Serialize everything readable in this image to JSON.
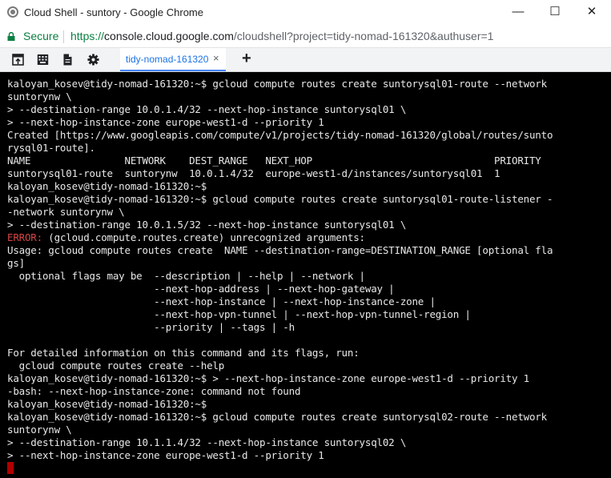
{
  "window": {
    "title": "Cloud Shell - suntory - Google Chrome",
    "controls": {
      "minimize": "—",
      "maximize": "☐",
      "close": "✕"
    }
  },
  "address_bar": {
    "secure_label": "Secure",
    "url_scheme": "https://",
    "url_host": "console.cloud.google.com",
    "url_path": "/cloudshell?project=tidy-nomad-161320&authuser=1"
  },
  "toolbar": {
    "icons": [
      "open-in-new-window-icon",
      "keyboard-icon",
      "file-icon",
      "gear-icon"
    ],
    "tab_label": "tidy-nomad-161320",
    "tab_close": "×",
    "add_tab": "+"
  },
  "terminal": {
    "lines": [
      "kaloyan_kosev@tidy-nomad-161320:~$ gcloud compute routes create suntorysql01-route --network",
      "suntorynw \\",
      "> --destination-range 10.0.1.4/32 --next-hop-instance suntorysql01 \\",
      "> --next-hop-instance-zone europe-west1-d --priority 1",
      "Created [https://www.googleapis.com/compute/v1/projects/tidy-nomad-161320/global/routes/sunto",
      "rysql01-route].",
      "NAME                NETWORK    DEST_RANGE   NEXT_HOP                               PRIORITY",
      "suntorysql01-route  suntorynw  10.0.1.4/32  europe-west1-d/instances/suntorysql01  1",
      "kaloyan_kosev@tidy-nomad-161320:~$",
      "kaloyan_kosev@tidy-nomad-161320:~$ gcloud compute routes create suntorysql01-route-listener -",
      "-network suntorynw \\",
      "> --destination-range 10.0.1.5/32 --next-hop-instance suntorysql01 \\",
      "(gcloud.compute.routes.create) unrecognized arguments:",
      "Usage: gcloud compute routes create  NAME --destination-range=DESTINATION_RANGE [optional fla",
      "gs]",
      "  optional flags may be  --description | --help | --network |",
      "                         --next-hop-address | --next-hop-gateway |",
      "                         --next-hop-instance | --next-hop-instance-zone |",
      "                         --next-hop-vpn-tunnel | --next-hop-vpn-tunnel-region |",
      "                         --priority | --tags | -h",
      "",
      "For detailed information on this command and its flags, run:",
      "  gcloud compute routes create --help",
      "kaloyan_kosev@tidy-nomad-161320:~$ > --next-hop-instance-zone europe-west1-d --priority 1",
      "-bash: --next-hop-instance-zone: command not found",
      "kaloyan_kosev@tidy-nomad-161320:~$",
      "kaloyan_kosev@tidy-nomad-161320:~$ gcloud compute routes create suntorysql02-route --network",
      "suntorynw \\",
      "> --destination-range 10.1.1.4/32 --next-hop-instance suntorysql02 \\",
      "> --next-hop-instance-zone europe-west1-d --priority 1"
    ],
    "error_prefix": "ERROR:",
    "error_line_index": 12,
    "colors": {
      "background": "#000000",
      "text": "#e8e8e8",
      "error": "#d64545",
      "cursor": "#b00000"
    }
  }
}
